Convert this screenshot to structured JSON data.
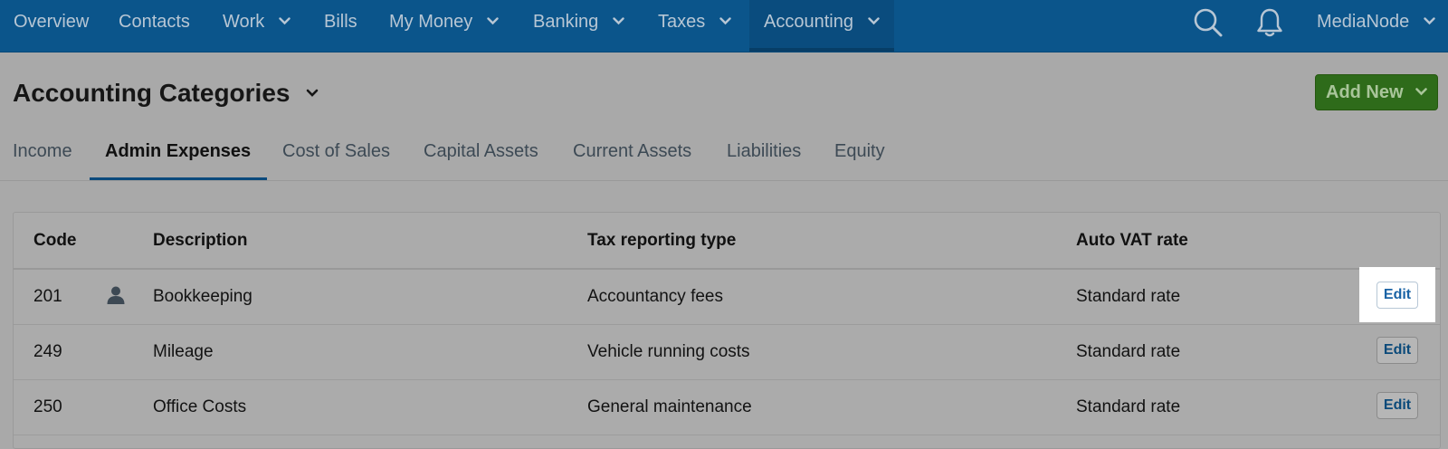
{
  "nav": {
    "items": [
      {
        "label": "Overview",
        "dropdown": false
      },
      {
        "label": "Contacts",
        "dropdown": false
      },
      {
        "label": "Work",
        "dropdown": true
      },
      {
        "label": "Bills",
        "dropdown": false
      },
      {
        "label": "My Money",
        "dropdown": true
      },
      {
        "label": "Banking",
        "dropdown": true
      },
      {
        "label": "Taxes",
        "dropdown": true
      },
      {
        "label": "Accounting",
        "dropdown": true,
        "active": true
      }
    ],
    "search_icon": "search-icon",
    "bell_icon": "bell-icon",
    "account": "MediaNode"
  },
  "header": {
    "title": "Accounting Categories",
    "add_button": "Add New"
  },
  "tabs": [
    {
      "label": "Income"
    },
    {
      "label": "Admin Expenses",
      "active": true
    },
    {
      "label": "Cost of Sales"
    },
    {
      "label": "Capital Assets"
    },
    {
      "label": "Current Assets"
    },
    {
      "label": "Liabilities"
    },
    {
      "label": "Equity"
    }
  ],
  "table": {
    "columns": [
      "Code",
      "Description",
      "Tax reporting type",
      "Auto VAT rate"
    ],
    "rows": [
      {
        "code": "201",
        "has_user_icon": true,
        "description": "Bookkeeping",
        "tax_type": "Accountancy fees",
        "vat": "Standard rate",
        "action": "Edit"
      },
      {
        "code": "249",
        "has_user_icon": false,
        "description": "Mileage",
        "tax_type": "Vehicle running costs",
        "vat": "Standard rate",
        "action": "Edit"
      },
      {
        "code": "250",
        "has_user_icon": false,
        "description": "Office Costs",
        "tax_type": "General maintenance",
        "vat": "Standard rate",
        "action": "Edit"
      }
    ]
  },
  "colors": {
    "nav_bg": "#0b558b",
    "nav_active_bg": "#0a4c7e",
    "add_button_bg": "#2e6b1a",
    "page_bg": "#a9a9a9",
    "edit_text": "#0b4a7a"
  }
}
